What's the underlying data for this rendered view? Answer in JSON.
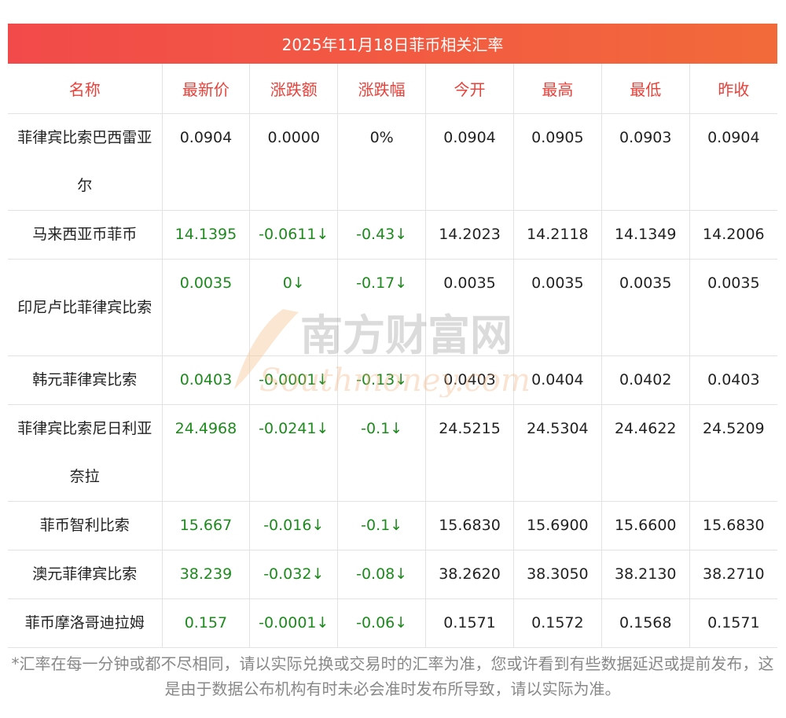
{
  "title": "2025年11月18日菲币相关汇率",
  "headers": [
    "名称",
    "最新价",
    "涨跌额",
    "涨跌幅",
    "今开",
    "最高",
    "最低",
    "昨收"
  ],
  "rows": [
    {
      "name": "菲律宾比索巴西雷亚尔",
      "latest": "0.0904",
      "change": "0.0000",
      "pct": "0%",
      "open": "0.0904",
      "high": "0.0905",
      "low": "0.0903",
      "prev": "0.0904",
      "colored": false
    },
    {
      "name": "马来西亚币菲币",
      "latest": "14.1395",
      "change": "-0.0611↓",
      "pct": "-0.43↓",
      "open": "14.2023",
      "high": "14.2118",
      "low": "14.1349",
      "prev": "14.2006",
      "colored": true
    },
    {
      "name": "印尼卢比菲律宾比索",
      "latest": "0.0035",
      "change": "0↓",
      "pct": "-0.17↓",
      "open": "0.0035",
      "high": "0.0035",
      "low": "0.0035",
      "prev": "0.0035",
      "colored": true
    },
    {
      "name": "韩元菲律宾比索",
      "latest": "0.0403",
      "change": "-0.0001↓",
      "pct": "-0.13↓",
      "open": "0.0403",
      "high": "0.0404",
      "low": "0.0402",
      "prev": "0.0403",
      "colored": true
    },
    {
      "name": "菲律宾比索尼日利亚奈拉",
      "latest": "24.4968",
      "change": "-0.0241↓",
      "pct": "-0.1↓",
      "open": "24.5215",
      "high": "24.5304",
      "low": "24.4622",
      "prev": "24.5209",
      "colored": true
    },
    {
      "name": "菲币智利比索",
      "latest": "15.667",
      "change": "-0.016↓",
      "pct": "-0.1↓",
      "open": "15.6830",
      "high": "15.6900",
      "low": "15.6600",
      "prev": "15.6830",
      "colored": true
    },
    {
      "name": "澳元菲律宾比索",
      "latest": "38.239",
      "change": "-0.032↓",
      "pct": "-0.08↓",
      "open": "38.2620",
      "high": "38.3050",
      "low": "38.2130",
      "prev": "38.2710",
      "colored": true
    },
    {
      "name": "菲币摩洛哥迪拉姆",
      "latest": "0.157",
      "change": "-0.0001↓",
      "pct": "-0.06↓",
      "open": "0.1571",
      "high": "0.1572",
      "low": "0.1568",
      "prev": "0.1571",
      "colored": true
    }
  ],
  "watermark": {
    "cn": "南方财富网",
    "en": "Southmoney.com"
  },
  "footnote": "*汇率在每一分钟或都不尽相同，请以实际兑换或交易时的汇率为准，您或许看到有些数据延迟或提前发布，这是由于数据公布机构有时未必会准时发布所导致，请以实际为准。",
  "colors": {
    "title_bar": "#f24a4a",
    "header_text": "#e8413a",
    "green": "#1e8a1e"
  }
}
